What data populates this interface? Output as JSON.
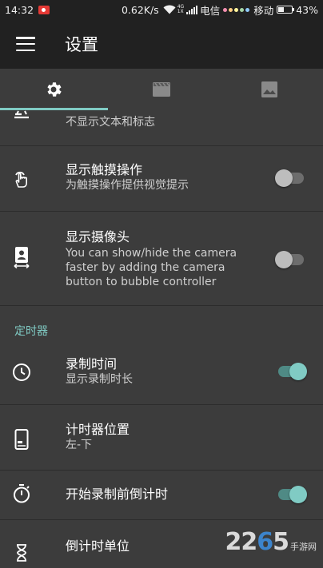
{
  "status_bar": {
    "time": "14:32",
    "speed": "0.62K/s",
    "net_type_top": "4G",
    "net_type_bottom": "1X",
    "carrier1": "电信",
    "carrier2": "移动",
    "battery_percent_label": "43%",
    "battery_level": 0.43,
    "dot_colors": [
      "#f48fb1",
      "#ffcc80",
      "#fff59d",
      "#a5d6a7",
      "#90caf9"
    ]
  },
  "app_bar": {
    "title": "设置"
  },
  "tabs": {
    "items": [
      {
        "icon": "gear-icon",
        "active": true
      },
      {
        "icon": "clapperboard-icon",
        "active": false
      },
      {
        "icon": "image-icon",
        "active": false
      }
    ]
  },
  "settings": {
    "row0": {
      "subtitle": "不显示文本和标志"
    },
    "row1": {
      "title": "显示触摸操作",
      "subtitle": "为触摸操作提供视觉提示",
      "toggle_on": false
    },
    "row2": {
      "title": "显示摄像头",
      "subtitle": "You can show/hide the camera faster by adding the camera button to bubble controller",
      "toggle_on": false
    },
    "section_timer": "定时器",
    "row3": {
      "title": "录制时间",
      "subtitle": "显示录制时长",
      "toggle_on": true
    },
    "row4": {
      "title": "计时器位置",
      "subtitle": "左-下"
    },
    "row5": {
      "title": "开始录制前倒计时",
      "toggle_on": true
    },
    "row6": {
      "title": "倒计时单位"
    }
  },
  "colors": {
    "accent": "#80cbc4",
    "background": "#3c3c3c",
    "toolbar": "#212121"
  },
  "watermark": {
    "number_part1": "22",
    "number_part2": "6",
    "number_part3": "5",
    "cn": "手游网"
  }
}
